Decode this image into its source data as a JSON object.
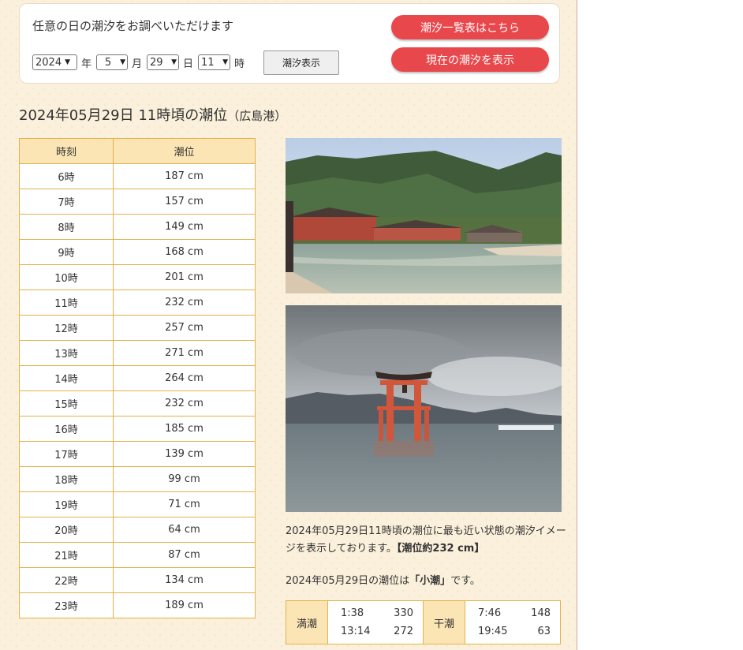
{
  "search": {
    "title": "任意の日の潮汐をお調べいただけます",
    "year": "2024",
    "year_unit": "年",
    "month": "5",
    "month_unit": "月",
    "day": "29",
    "day_unit": "日",
    "hour": "11",
    "hour_unit": "時",
    "show_button": "潮汐表示",
    "list_button": "潮汐一覧表はこちら",
    "now_button": "現在の潮汐を表示"
  },
  "heading": {
    "main": "2024年05月29日 11時頃の潮位",
    "port": "（広島港）"
  },
  "table": {
    "col_time": "時刻",
    "col_level": "潮位",
    "rows": [
      {
        "time": "6時",
        "level": "187 cm"
      },
      {
        "time": "7時",
        "level": "157 cm"
      },
      {
        "time": "8時",
        "level": "149 cm"
      },
      {
        "time": "9時",
        "level": "168 cm"
      },
      {
        "time": "10時",
        "level": "201 cm"
      },
      {
        "time": "11時",
        "level": "232 cm"
      },
      {
        "time": "12時",
        "level": "257 cm"
      },
      {
        "time": "13時",
        "level": "271 cm"
      },
      {
        "time": "14時",
        "level": "264 cm"
      },
      {
        "time": "15時",
        "level": "232 cm"
      },
      {
        "time": "16時",
        "level": "185 cm"
      },
      {
        "time": "17時",
        "level": "139 cm"
      },
      {
        "time": "18時",
        "level": "99 cm"
      },
      {
        "time": "19時",
        "level": "71 cm"
      },
      {
        "time": "20時",
        "level": "64 cm"
      },
      {
        "time": "21時",
        "level": "87 cm"
      },
      {
        "time": "22時",
        "level": "134 cm"
      },
      {
        "time": "23時",
        "level": "189 cm"
      }
    ]
  },
  "description": {
    "text": "2024年05月29日11時頃の潮位に最も近い状態の潮汐イメージを表示しております。",
    "level_note": "【潮位約232 cm】"
  },
  "tide_type": {
    "prefix": "2024年05月29日の潮位は",
    "value": "「小潮」",
    "suffix": "です。"
  },
  "high_low": {
    "high_label": "満潮",
    "low_label": "干潮",
    "high": [
      {
        "time": "1:38",
        "level": "330"
      },
      {
        "time": "13:14",
        "level": "272"
      }
    ],
    "low": [
      {
        "time": "7:46",
        "level": "148"
      },
      {
        "time": "19:45",
        "level": "63"
      }
    ]
  },
  "colors": {
    "accent_red": "#e8474c",
    "table_header": "#fbe5b4",
    "table_border": "#e2b24a",
    "background": "#fbf0dc"
  }
}
